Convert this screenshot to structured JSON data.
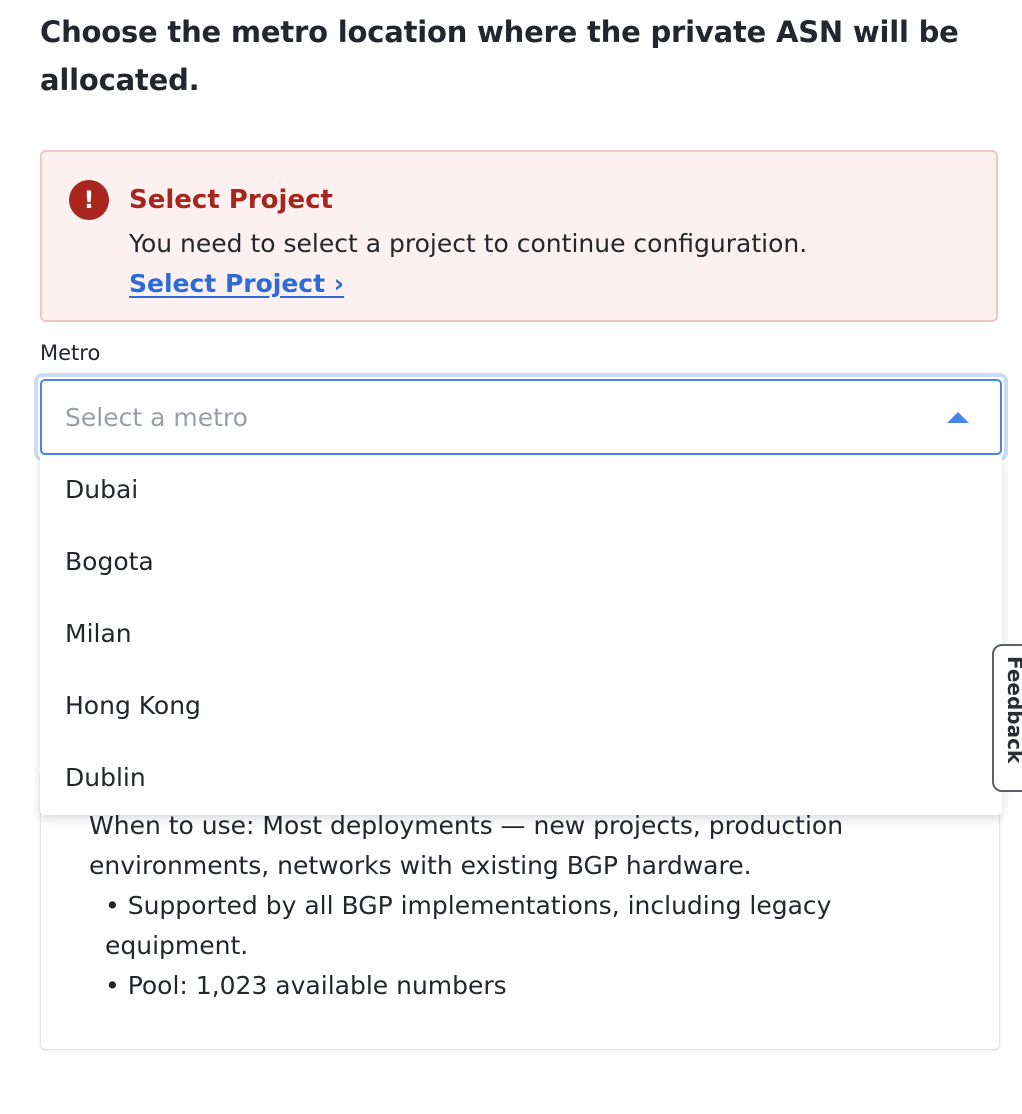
{
  "page": {
    "heading": "Choose the metro location where the private ASN will be allocated."
  },
  "alert": {
    "icon": "exclamation-circle-icon",
    "icon_glyph": "!",
    "title": "Select Project",
    "message": "You need to select a project to continue configuration.",
    "link_label": "Select Project ›",
    "colors": {
      "background": "#fdf0f0",
      "border": "#f2c6c6",
      "title": "#a8261d",
      "link": "#2d6bd9"
    }
  },
  "metro_field": {
    "label": "Metro",
    "placeholder": "Select a metro",
    "caret_icon": "caret-up-icon",
    "accent_color": "#4a86e8",
    "options": [
      "Dubai",
      "Bogota",
      "Milan",
      "Hong Kong",
      "Dublin"
    ]
  },
  "info_card": {
    "usage": "When to use: Most deployments — new projects, production environments, networks with existing BGP hardware.",
    "bullets": [
      "Supported by all BGP implementations, including legacy equipment.",
      "Pool: 1,023 available numbers"
    ]
  },
  "feedback": {
    "label": "Feedback"
  }
}
